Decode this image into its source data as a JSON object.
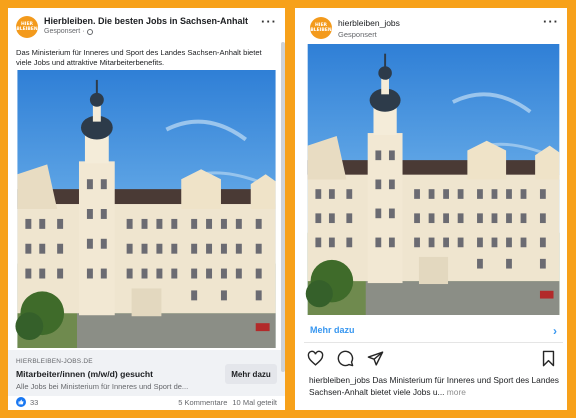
{
  "facebook_ad": {
    "page_name": "Hierbleiben. Die besten Jobs in Sachsen-Anhalt",
    "sponsored": "Gesponsert",
    "logo_text": [
      "HIER",
      "BLEIBEN"
    ],
    "body_text": "Das Ministerium für Inneres und Sport des Landes Sachsen-Anhalt bietet viele Jobs und attraktive Mitarbeiterbenefits.",
    "link": {
      "domain": "HIERBLEIBEN-JOBS.DE",
      "title": "Mitarbeiter/innen (m/w/d) gesucht",
      "description": "Alle Jobs bei Ministerium für Inneres und Sport de..."
    },
    "cta_label": "Mehr dazu",
    "reactions_count": "33",
    "comments": "5 Kommentare",
    "shares": "10 Mal geteilt"
  },
  "instagram_ad": {
    "account": "hierbleiben_jobs",
    "sponsored": "Gesponsert",
    "logo_text": [
      "HIER",
      "BLEIBEN"
    ],
    "more_label": "Mehr dazu",
    "caption_account": "hierbleiben_jobs",
    "caption_text": " Das Ministerium für Inneres und Sport des Landes Sachsen-Anhalt bietet viele Jobs u...",
    "caption_more": " more"
  },
  "colors": {
    "frame": "#f7a11a",
    "brand_orange": "#f39a1c",
    "fb_blue": "#1877f2",
    "ig_link": "#3897f0"
  }
}
